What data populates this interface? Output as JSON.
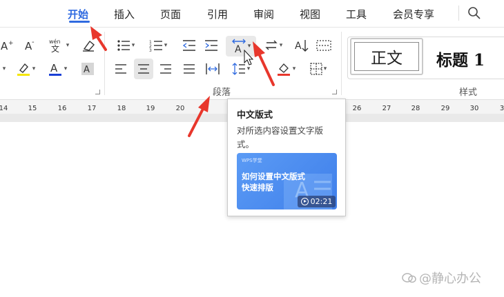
{
  "menu": {
    "tabs": [
      {
        "label": "开始",
        "active": true
      },
      {
        "label": "插入"
      },
      {
        "label": "页面"
      },
      {
        "label": "引用"
      },
      {
        "label": "审阅"
      },
      {
        "label": "视图"
      },
      {
        "label": "工具"
      },
      {
        "label": "会员专享"
      }
    ],
    "search_icon": "search-icon"
  },
  "ribbon": {
    "groups": {
      "paragraph_label": "段落",
      "styles_label": "样式"
    },
    "font_row1": [
      "font-size-increase-icon",
      "font-size-decrease-icon",
      "phonetic-guide-icon",
      "clear-format-icon"
    ],
    "font_row2": [
      "highlight-color-icon",
      "font-color-icon",
      "character-shading-icon"
    ],
    "paragraph_row1": [
      "bullet-list-icon",
      "numbered-list-icon",
      "decrease-indent-icon",
      "increase-indent-icon",
      "chinese-layout-icon",
      "text-direction-icon",
      "sort-icon",
      "show-hide-marks-icon"
    ],
    "paragraph_row2": [
      "align-left-icon",
      "align-center-icon",
      "align-right-icon",
      "justify-icon",
      "distributed-align-icon",
      "line-spacing-icon",
      "shading-icon",
      "borders-icon"
    ],
    "styles": {
      "normal": "正文",
      "heading1": "标题  1"
    },
    "font_color": "#1a3fd6",
    "highlight_color": "#f5e600"
  },
  "ruler": {
    "numbers": [
      "14",
      "15",
      "16",
      "17",
      "18",
      "19",
      "20",
      "26",
      "27",
      "28",
      "29",
      "30",
      "3"
    ]
  },
  "tooltip": {
    "title": "中文版式",
    "description": "对所选内容设置文字版式。",
    "video": {
      "tag": "WPS学堂",
      "line1": "如何设置中文版式",
      "line2": "快速排版",
      "duration": "02:21"
    }
  },
  "annotation_color": "#e8372c",
  "watermark": "@静心办公",
  "accent_color": "#2f6ae0"
}
